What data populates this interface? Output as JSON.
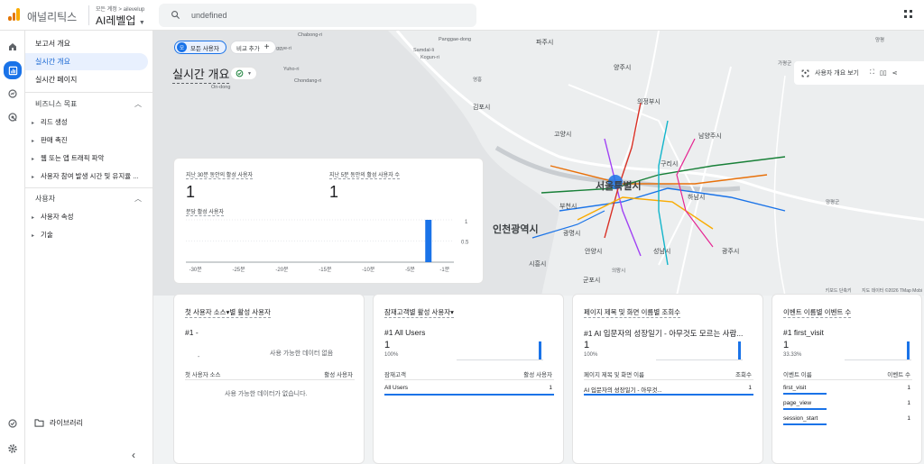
{
  "app": {
    "name": "애널리틱스",
    "breadcrumb": "모든 계정 > ailevelup",
    "property": "AI레벨업",
    "search_value": "undefined",
    "logo_colors": [
      "#f9ab00",
      "#e37400",
      "#e37400"
    ]
  },
  "nav": {
    "reports_overview": "보고서 개요",
    "realtime_overview": "실시간 개요",
    "realtime_pages": "실시간 페이지",
    "business_section": "비즈니스 목표",
    "business_items": [
      "리드 생성",
      "판매 촉진",
      "웹 또는 앱 트래픽 파악",
      "사용자 참여 발생 시간 및 유지율 ..."
    ],
    "user_section": "사용자",
    "user_items": [
      "사용자 속성",
      "기술"
    ],
    "library": "라이브러리"
  },
  "filters": {
    "all_users": "모든 사용자",
    "all_users_badge": "모",
    "compare": "비교 추가"
  },
  "page": {
    "title": "실시간 개요",
    "tools_label": "사용자 개요 보기"
  },
  "map": {
    "labels": [
      {
        "text": "Chabong-ri",
        "size": "sm"
      },
      {
        "text": "Panggae-dong",
        "size": "sm"
      },
      {
        "text": "Samdal-li",
        "size": "sm"
      },
      {
        "text": "Kogun-ri",
        "size": "sm"
      },
      {
        "text": "onggye-ri",
        "size": "sm"
      },
      {
        "text": "Yuho-ri",
        "size": "sm"
      },
      {
        "text": "Chondang-ri",
        "size": "sm"
      },
      {
        "text": "On-dong",
        "size": "sm"
      },
      {
        "text": "파주시",
        "size": "md"
      },
      {
        "text": "양주시",
        "size": "md"
      },
      {
        "text": "의정부시",
        "size": "md"
      },
      {
        "text": "김포시",
        "size": "md"
      },
      {
        "text": "고양시",
        "size": "md"
      },
      {
        "text": "남양주시",
        "size": "md"
      },
      {
        "text": "구리시",
        "size": "md"
      },
      {
        "text": "서울특별시",
        "size": "big"
      },
      {
        "text": "하남시",
        "size": "md"
      },
      {
        "text": "부천시",
        "size": "md"
      },
      {
        "text": "인천광역시",
        "size": "big"
      },
      {
        "text": "광명시",
        "size": "md"
      },
      {
        "text": "안양시",
        "size": "md"
      },
      {
        "text": "성남시",
        "size": "md"
      },
      {
        "text": "광주시",
        "size": "md"
      },
      {
        "text": "시흥시",
        "size": "md"
      },
      {
        "text": "의왕시",
        "size": "sm"
      },
      {
        "text": "군포시",
        "size": "md"
      },
      {
        "text": "양평군",
        "size": "sm"
      },
      {
        "text": "가평군",
        "size": "sm"
      },
      {
        "text": "영흥",
        "size": "sm"
      },
      {
        "text": "양평",
        "size": "sm"
      }
    ],
    "attribution_keyboard": "키보드 단축키",
    "attribution_data": "지도 데이터 ©2026 TMap Mobi"
  },
  "realtime_card": {
    "users_30min_label": "지난 30분 동안의 활성 사용자",
    "users_30min_value": "1",
    "users_5min_label": "지난 5분 동안의 활성 사용자 수",
    "users_5min_value": "1",
    "per_minute_label": "분당 활성 사용자",
    "y_ticks": [
      "1",
      "0.5"
    ],
    "x_ticks": [
      "-30분",
      "-25분",
      "-20분",
      "-15분",
      "-10분",
      "-5분",
      "-1분"
    ]
  },
  "chart_data": {
    "type": "bar",
    "title": "분당 활성 사용자",
    "categories": [
      "-30분",
      "-25분",
      "-20분",
      "-15분",
      "-10분",
      "-5분",
      "-1분"
    ],
    "highlight_value": 1,
    "highlight_position": "-3분",
    "ylim": [
      0,
      1
    ],
    "grid": true
  },
  "cards": {
    "first_source": {
      "title": "첫 사용자 소스▾별 활성 사용자",
      "rank": "#1  -",
      "no_data": "사용 가능한 데이터 없음",
      "dash": "-",
      "col1": "첫 사용자 소스",
      "col2": "활성 사용자",
      "empty_row": "사용 가능한 데이터가 없습니다."
    },
    "audience": {
      "title": "잠재고객별 활성 사용자▾",
      "rank": "#1  All Users",
      "value": "1",
      "pct": "100%",
      "col1": "잠재고객",
      "col2": "활성 사용자",
      "rows": [
        {
          "name": "All Users",
          "value": "1"
        }
      ]
    },
    "page_views": {
      "title": "페이지 제목 및 화면 이름별 조회수",
      "rank": "#1  AI 입문자의 성장일기 - 아무것도 모르는 사람...",
      "value": "1",
      "pct": "100%",
      "col1": "페이지 제목 및 화면 이름",
      "col2": "조회수",
      "rows": [
        {
          "name": "AI 입문자의 성장일기 - 아무것...",
          "value": "1"
        }
      ]
    },
    "events": {
      "title": "이벤트 이름별 이벤트 수",
      "rank": "#1  first_visit",
      "value": "1",
      "pct": "33.33%",
      "col1": "이벤트 이름",
      "col2": "이벤트 수",
      "rows": [
        {
          "name": "first_visit",
          "value": "1"
        },
        {
          "name": "page_view",
          "value": "1"
        },
        {
          "name": "session_start",
          "value": "1"
        }
      ]
    }
  },
  "colors": {
    "accent": "#1a73e8",
    "accent_light": "#e8f0fe"
  }
}
